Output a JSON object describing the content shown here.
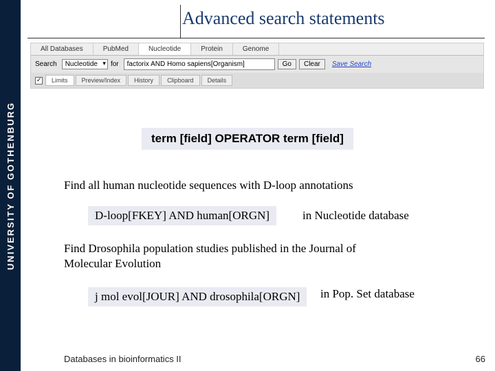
{
  "sidebar_text": "UNIVERSITY OF GOTHENBURG",
  "title": "Advanced search statements",
  "searchbar": {
    "tabs": [
      "All Databases",
      "PubMed",
      "Nucleotide",
      "Protein",
      "Genome"
    ],
    "search_label": "Search",
    "db_selected": "Nucleotide",
    "for_label": "for",
    "query": "factorix AND Homo sapiens[Organism]",
    "go": "Go",
    "clear": "Clear",
    "save": "Save Search",
    "limits": "Limits",
    "preview": "Preview/Index",
    "history": "History",
    "clipboard": "Clipboard",
    "details": "Details"
  },
  "syntax": "term [field] OPERATOR term [field]",
  "para1": "Find all human nucleotide sequences with D-loop annotations",
  "example1": "D-loop[FKEY] AND human[ORGN]",
  "db1": "in Nucleotide database",
  "para2a": "Find Drosophila population studies published in the Journal of",
  "para2b": "Molecular Evolution",
  "example2": "j mol evol[JOUR] AND drosophila[ORGN]",
  "db2": "in Pop. Set database",
  "footer_left": "Databases in bioinformatics II",
  "footer_right": "66"
}
